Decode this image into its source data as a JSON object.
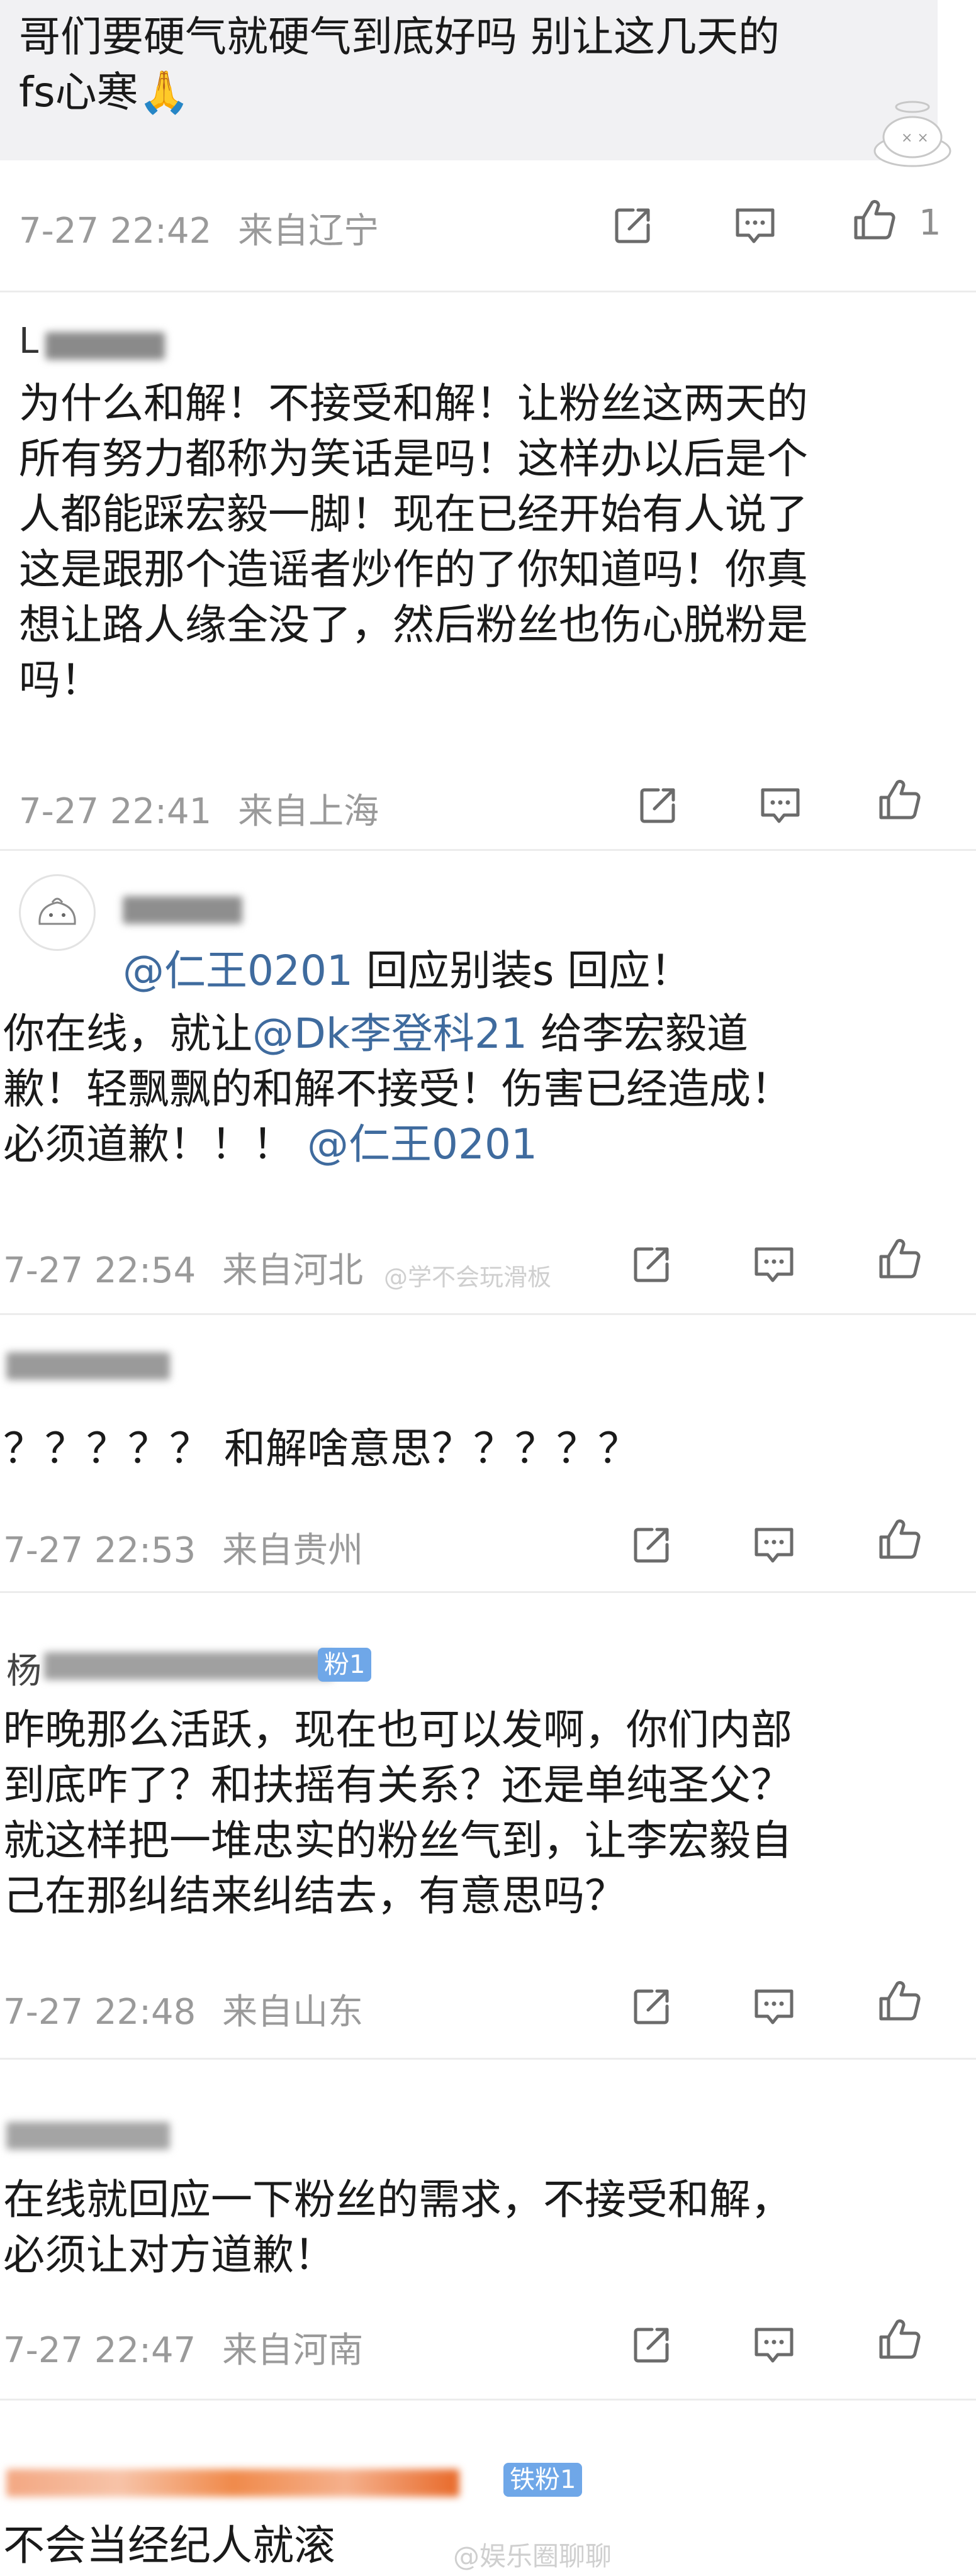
{
  "comments": [
    {
      "lines": [
        "哥们要硬气就硬气到底好吗 别让这几天的",
        "fs心寒🙏"
      ],
      "time": "7-27 22:42",
      "location": "来自辽宁",
      "like_count": "1"
    },
    {
      "user_initial": "L",
      "lines": [
        "为什么和解！不接受和解！让粉丝这两天的",
        "所有努力都称为笑话是吗！这样办以后是个",
        "人都能踩宏毅一脚！现在已经开始有人说了",
        "这是跟那个造谣者炒作的了你知道吗！你真",
        "想让路人缘全没了，然后粉丝也伤心脱粉是",
        "吗！"
      ],
      "time": "7-27 22:41",
      "location": "来自上海"
    },
    {
      "mention1": "@仁王0201",
      "reply1": " 回应别装s 回应！",
      "line2a": "你在线，就让",
      "mention2": "@Dk李登科21",
      "line2b": " 给李宏毅道",
      "line3": "歉！轻飘飘的和解不接受！伤害已经造成！",
      "line4a": "必须道歉！！！ ",
      "mention3": "@仁王0201",
      "time": "7-27 22:54",
      "location": "来自河北",
      "watermark": "@学不会玩滑板"
    },
    {
      "lines": [
        "？？？？？ 和解啥意思？？？？？"
      ],
      "time": "7-27 22:53",
      "location": "来自贵州"
    },
    {
      "user_initial": "杨",
      "badge": "粉1",
      "lines": [
        "昨晚那么活跃，现在也可以发啊，你们内部",
        "到底咋了？和扶摇有关系？还是单纯圣父？",
        "就这样把一堆忠实的粉丝气到，让李宏毅自",
        "己在那纠结来纠结去，有意思吗？"
      ],
      "time": "7-27 22:48",
      "location": "来自山东"
    },
    {
      "lines": [
        "在线就回应一下粉丝的需求，不接受和解，",
        "必须让对方道歉！"
      ],
      "time": "7-27 22:47",
      "location": "来自河南"
    },
    {
      "badge": "铁粉1",
      "lines": [
        "不会当经纪人就滚"
      ],
      "watermark": "@娱乐圈聊聊"
    }
  ],
  "icons": [
    "share-icon",
    "comment-icon",
    "like-icon"
  ],
  "colors": {
    "mention": "#3f6b9e",
    "meta": "#9a9a9a",
    "bubble": "#f1f1f3",
    "badge": "#6fa7e8"
  }
}
